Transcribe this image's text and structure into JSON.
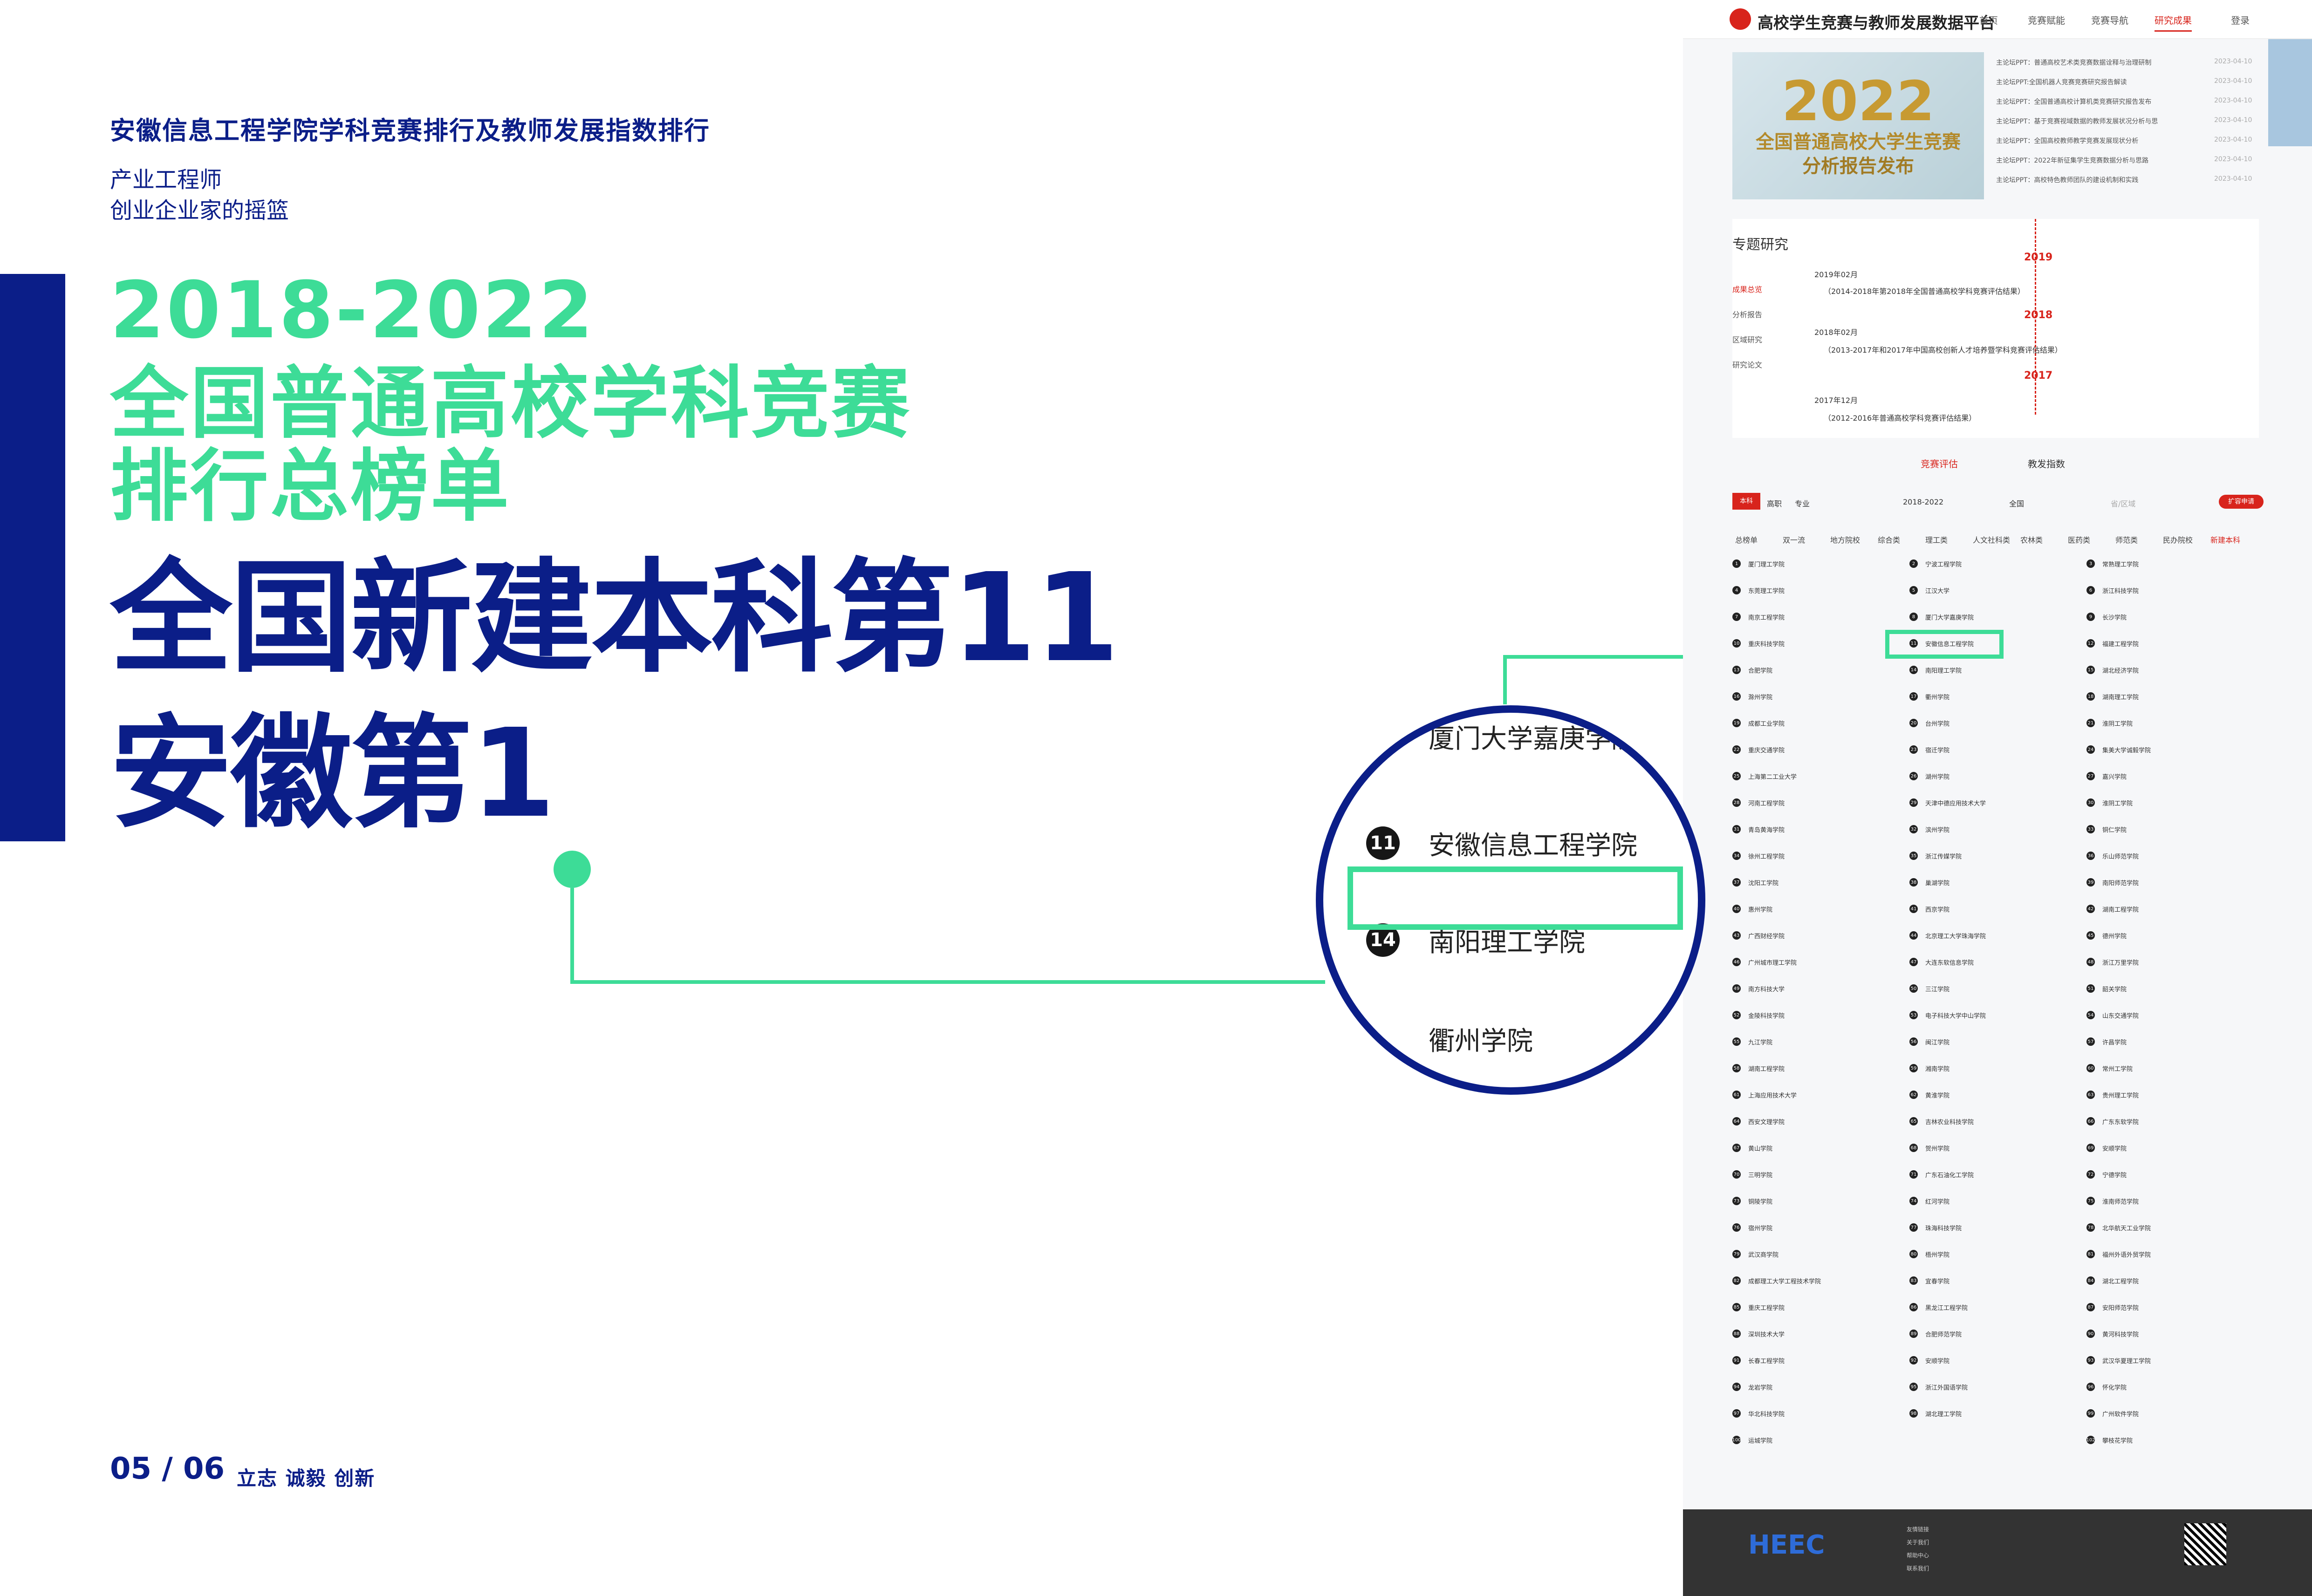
{
  "heading": "安徽信息工程学院学科竞赛排行及教师发展指数排行",
  "tagline": [
    "产业工程师",
    "创业企业家的摇篮"
  ],
  "green_title": [
    "2018-2022",
    "全国普通高校学科竞赛",
    "排行总榜单"
  ],
  "blue_title": [
    "全国新建本科第11",
    "安徽第1"
  ],
  "page_num": "05 / 06",
  "motto": "立志  诚毅  创新",
  "zoom_items": [
    {
      "rank": "8",
      "name": "厦门大学嘉庚学院"
    },
    {
      "rank": "11",
      "name": "安徽信息工程学院"
    },
    {
      "rank": "14",
      "name": "南阳理工学院"
    },
    {
      "rank": "",
      "name": "衢州学院"
    }
  ],
  "platform": {
    "title": "高校学生竞赛与教师发展数据平台",
    "nav": [
      "首页",
      "竞赛赋能",
      "竞赛导航",
      "研究成果",
      "登录"
    ],
    "banner": [
      "2022",
      "全国普通高校大学生竞赛",
      "分析报告发布"
    ],
    "news": [
      "主论坛PPT：普通高校艺术类竞赛数据诠释与治理研制",
      "主论坛PPT:全国机器人竞赛竞赛研究报告解读",
      "主论坛PPT：全国普通高校计算机类竞赛研究报告发布",
      "主论坛PPT：基于竞赛视域数据的教师发展状况分析与思",
      "主论坛PPT：全国高校教师教学竞赛发展现状分析",
      "主论坛PPT：2022年新征集学生竞赛数据分析与思路",
      "主论坛PPT：高校特色教师团队的建设机制和实践"
    ],
    "news_date": "2023-04-10",
    "section": "专题研究",
    "menu": [
      "成果总览",
      "分析报告",
      "区域研究",
      "研究论文"
    ],
    "timeline": [
      {
        "year": "2019",
        "date": "2019年02月",
        "text": "（2014-2018年第2018年全国普通高校学科竞赛评估结果）"
      },
      {
        "year": "2018",
        "date": "2018年02月",
        "text": "（2013-2017年和2017年中国高校创新人才培养暨学科竞赛评估结果）"
      },
      {
        "year": "2017",
        "date": "2017年12月",
        "text": "（2012-2016年普通高校学科竞赛评估结果）"
      }
    ],
    "tabs": [
      "竞赛评估",
      "教发指数"
    ],
    "level_tabs": [
      "本科",
      "高职",
      "专业"
    ],
    "filters": [
      "2018-2022",
      "全国",
      "省/区域"
    ],
    "apply": "扩容申请",
    "categories": [
      "总榜单",
      "双一流",
      "地方院校",
      "综合类",
      "理工类",
      "人文社科类",
      "农林类",
      "医药类",
      "师范类",
      "民办院校",
      "新建本科"
    ],
    "col1": [
      "厦门理工学院",
      "东莞理工学院",
      "南京工程学院",
      "重庆科技学院",
      "合肥学院",
      "滁州学院",
      "成都工业学院",
      "重庆交通学院",
      "上海第二工业大学",
      "河南工程学院",
      "青岛黄海学院",
      "徐州工程学院",
      "沈阳工学院",
      "惠州学院",
      "广西财经学院",
      "广州城市理工学院",
      "南方科技大学",
      "金陵科技学院",
      "九江学院",
      "湖南工程学院",
      "上海应用技术大学",
      "西安文理学院",
      "黄山学院",
      "三明学院",
      "铜陵学院",
      "宿州学院",
      "武汉商学院",
      "成都理工大学工程技术学院",
      "重庆工程学院",
      "深圳技术大学",
      "长春工程学院",
      "龙岩学院",
      "华北科技学院"
    ],
    "col2": [
      "宁波工程学院",
      "江汉大学",
      "厦门大学嘉庚学院",
      "安徽信息工程学院",
      "南阳理工学院",
      "衢州学院",
      "台州学院",
      "宿迁学院",
      "湖州学院",
      "天津中德应用技术大学",
      "滨州学院",
      "浙江传媒学院",
      "巢湖学院",
      "西京学院",
      "北京理工大学珠海学院",
      "大连东软信息学院",
      "三江学院",
      "电子科技大学中山学院",
      "闽江学院",
      "湘南学院",
      "黄淮学院",
      "吉林农业科技学院",
      "贺州学院",
      "广东石油化工学院",
      "红河学院",
      "珠海科技学院",
      "梧州学院",
      "宜春学院",
      "黑龙江工程学院",
      "合肥师范学院",
      "安顺学院",
      "浙江外国语学院",
      "湖北理工学院"
    ],
    "col3": [
      "常熟理工学院",
      "浙江科技学院",
      "长沙学院",
      "福建工程学院",
      "湖北经济学院",
      "湖南理工学院",
      "淮阴工学院",
      "集美大学诚毅学院",
      "嘉兴学院",
      "淮阴工学院",
      "铜仁学院",
      "乐山师范学院",
      "南阳师范学院",
      "湖南工程学院",
      "德州学院",
      "浙江万里学院",
      "韶关学院",
      "山东交通学院",
      "许昌学院",
      "常州工学院",
      "贵州理工学院",
      "广东东软学院",
      "安顺学院",
      "宁德学院",
      "淮南师范学院",
      "北华航天工业学院",
      "福州外语外贸学院",
      "湖北工程学院",
      "安阳师范学院",
      "黄河科技学院",
      "武汉华夏理工学院",
      "怀化学院",
      "广州软件学院",
      "攀枝花学院"
    ],
    "last": "运城学院",
    "footer": "HEEC",
    "footer_links": [
      "友情链接",
      "关于我们",
      "帮助中心",
      "联系我们"
    ]
  }
}
